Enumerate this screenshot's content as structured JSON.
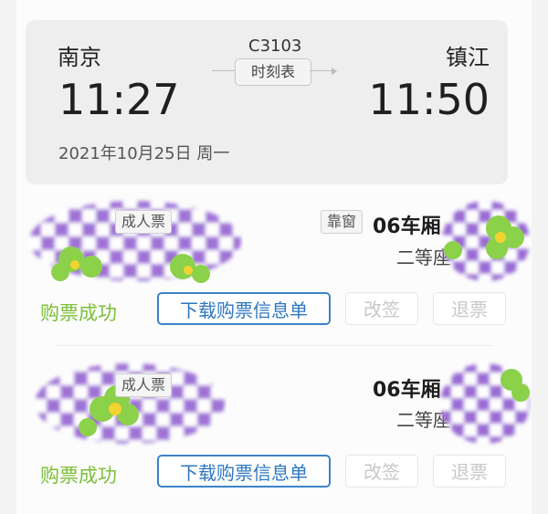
{
  "trip": {
    "from_station": "南京",
    "to_station": "镇江",
    "departure_time": "11:27",
    "arrival_time": "11:50",
    "train_number": "C3103",
    "timetable_label": "时刻表",
    "date": "2021年10月25日 周一"
  },
  "tickets": [
    {
      "ticket_type": "成人票",
      "window_tag": "靠窗",
      "carriage": "06车厢",
      "seat_class": "二等座",
      "status": "购票成功",
      "download_label": "下载购票信息单",
      "change_label": "改签",
      "refund_label": "退票"
    },
    {
      "ticket_type": "成人票",
      "carriage": "06车厢",
      "seat_class": "二等座",
      "status": "购票成功",
      "download_label": "下载购票信息单",
      "change_label": "改签",
      "refund_label": "退票"
    }
  ],
  "colors": {
    "accent_blue": "#2f77c0",
    "success_green": "#7bbf39",
    "disabled_gray": "#c8c8c8"
  }
}
